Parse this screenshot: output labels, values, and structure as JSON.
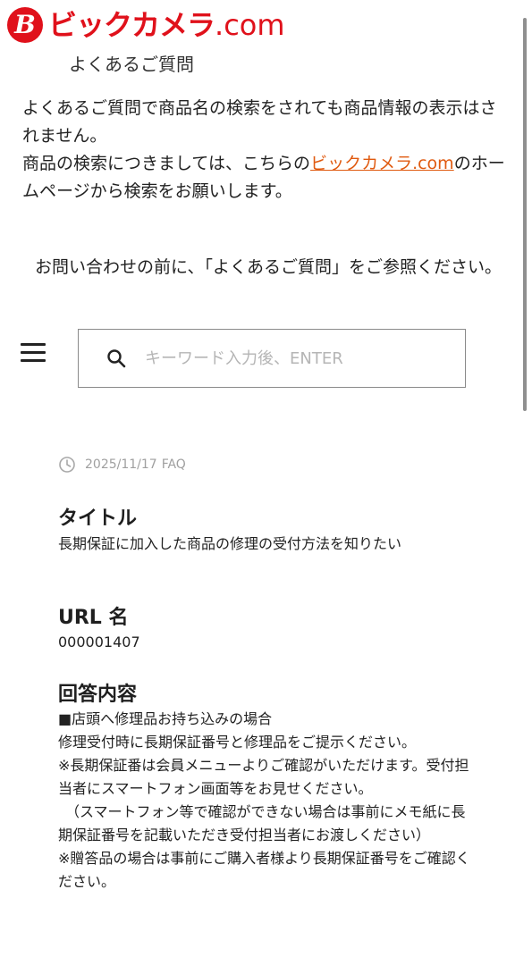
{
  "header": {
    "logo_mark": "B",
    "logo_text": "ビックカメラ",
    "logo_domain": ".com",
    "subtitle": "よくあるご質問"
  },
  "notice": {
    "line1": "よくあるご質問で商品名の検索をされても商品情報の表示はされません。",
    "line2_prefix": "商品の検索につきましては、こちらの",
    "link_text": "ビックカメラ.com",
    "line2_suffix": "のホームページから検索をお願いします。"
  },
  "prompt": "お問い合わせの前に、「よくあるご質問」をご参照ください。",
  "search": {
    "placeholder": "キーワード入力後、ENTER"
  },
  "article": {
    "date": "2025/11/17",
    "category": "FAQ",
    "title_label": "タイトル",
    "title_value": "長期保証に加入した商品の修理の受付方法を知りたい",
    "url_label": "URL 名",
    "url_value": "000001407",
    "answer_label": "回答内容",
    "answer_lines": [
      "■店頭へ修理品お持ち込みの場合",
      "修理受付時に長期保証番号と修理品をご提示ください。",
      "※長期保証番は会員メニューよりご確認がいただけます。受付担当者にスマートフォン画面等をお見せください。",
      "　（スマートフォン等で確認ができない場合は事前にメモ紙に長期保証番号を記載いただき受付担当者にお渡しください）",
      "※贈答品の場合は事前にご購入者様より長期保証番号をご確認ください。"
    ]
  },
  "colors": {
    "brand_red": "#e0111b",
    "link_orange": "#e05a10"
  }
}
